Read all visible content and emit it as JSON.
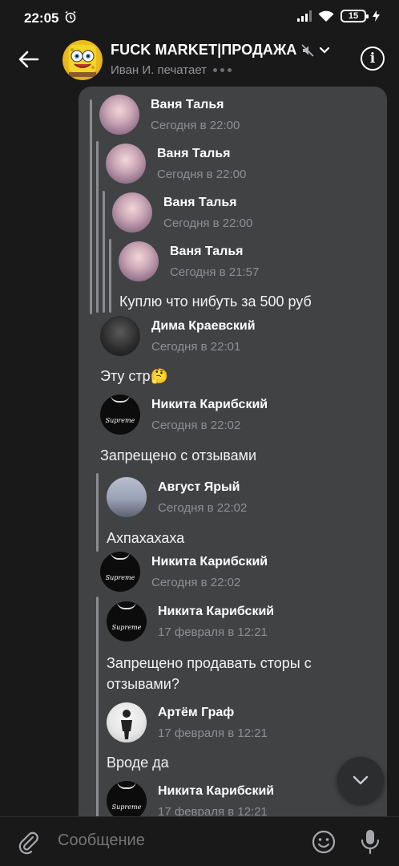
{
  "status_bar": {
    "time": "22:05",
    "battery": "15"
  },
  "header": {
    "title": "FUCK MARKET|ПРОДАЖА",
    "subtitle": "Иван И. печатает",
    "icons": [
      "back-arrow-icon",
      "muted-speaker-icon",
      "chevron-down-icon",
      "info-icon"
    ]
  },
  "messages": [
    {
      "name": "Ваня Талья",
      "date": "Сегодня в 22:00"
    },
    {
      "name": "Ваня Талья",
      "date": "Сегодня в 22:00"
    },
    {
      "name": "Ваня Талья",
      "date": "Сегодня в 22:00"
    },
    {
      "name": "Ваня Талья",
      "date": "Сегодня в 21:57",
      "text": "Куплю что нибуть за 500 руб"
    },
    {
      "name": "Дима Краевский",
      "date": "Сегодня в 22:01",
      "text": "Эту стр",
      "emoji": "🤔"
    },
    {
      "name": "Никита Карибский",
      "date": "Сегодня в 22:02",
      "text": "Запрещено с отзывами"
    },
    {
      "name": "Август Ярый",
      "date": "Сегодня в 22:02",
      "text": "Ахпахахаха"
    },
    {
      "name": "Никита Карибский",
      "date": "Сегодня в 22:02"
    },
    {
      "name": "Никита Карибский",
      "date": "17 февраля в 12:21",
      "text_line1": "Запрещено продавать сторы с",
      "text_line2": "отзывами?"
    },
    {
      "name": "Артём Граф",
      "date": "17 февраля в 12:21",
      "text": "Вроде да"
    },
    {
      "name": "Никита Карибский",
      "date": "17 февраля в 12:21"
    }
  ],
  "avatar_logo_text": "Supreme",
  "composer": {
    "placeholder": "Сообщение"
  },
  "colors": {
    "background": "#19191a",
    "bubble": "#414244",
    "muted_text": "#8d8f94"
  }
}
